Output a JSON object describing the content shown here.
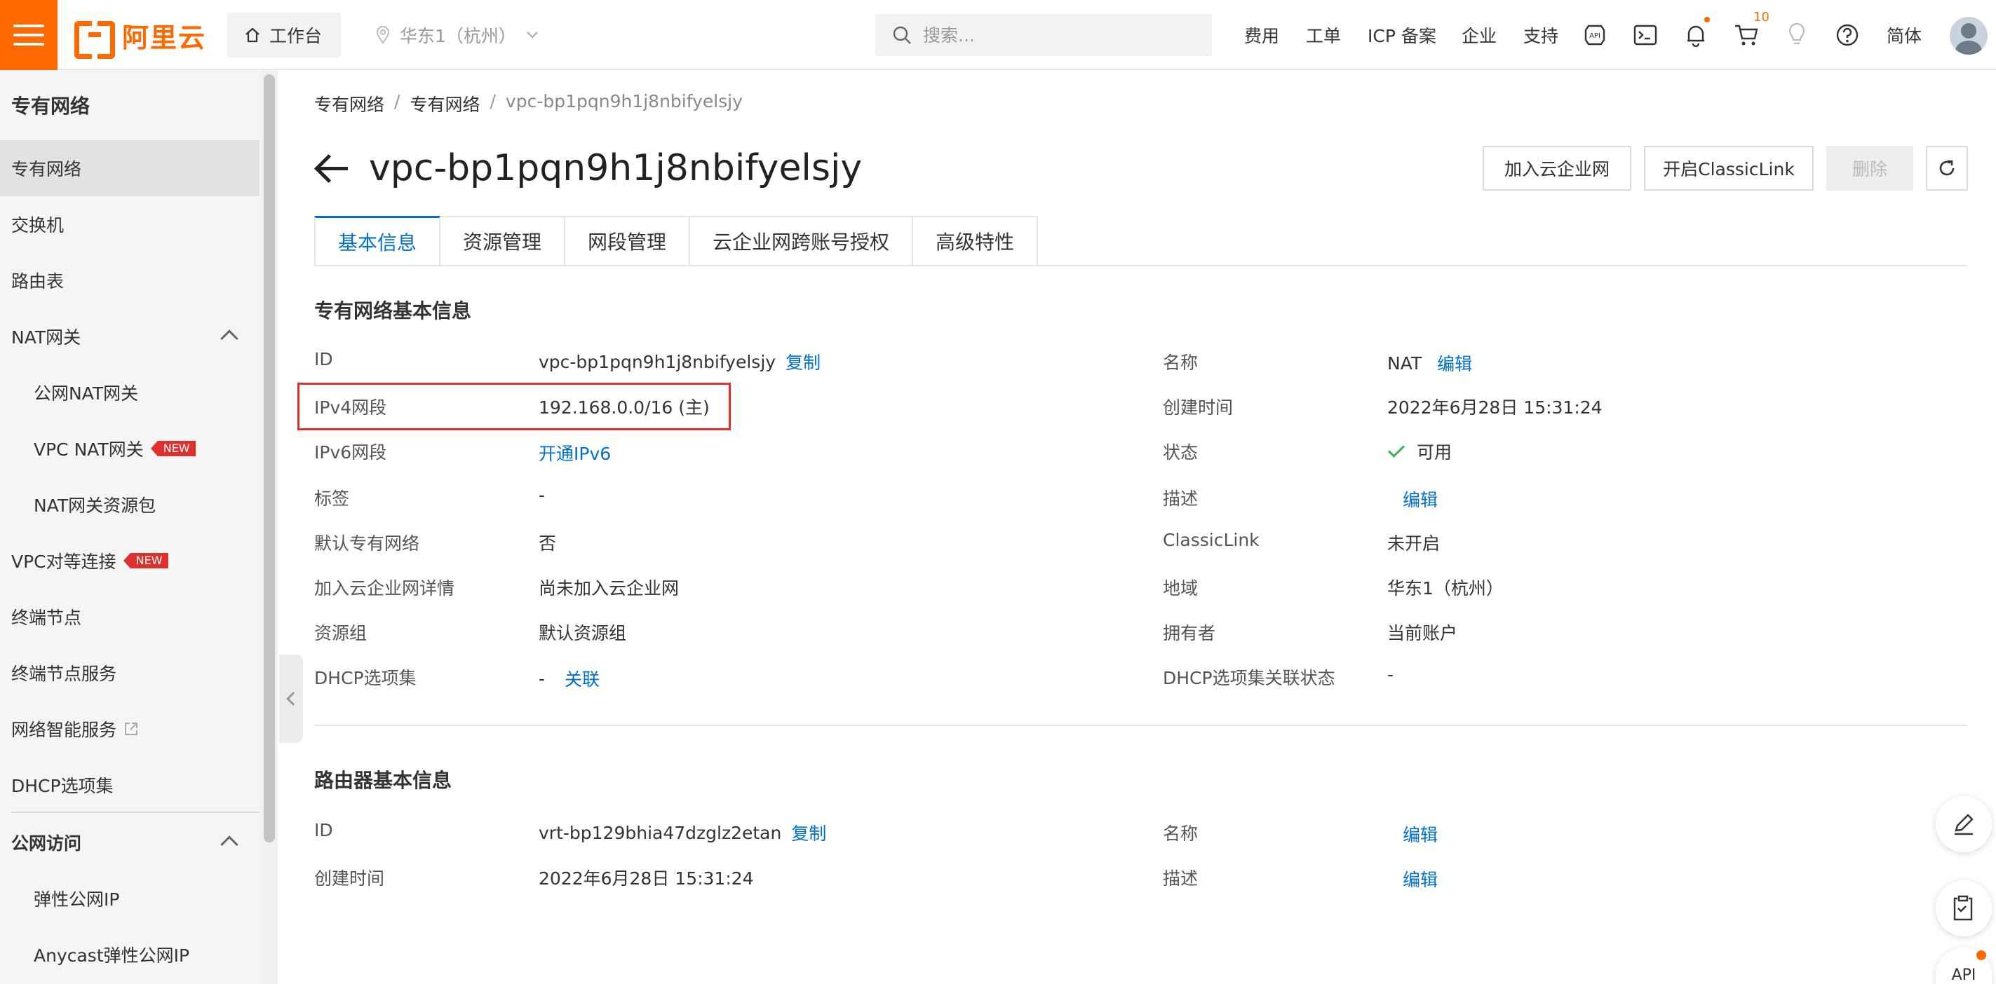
{
  "brand": {
    "name": "阿里云",
    "color": "#ff6a00"
  },
  "topbar": {
    "workbench": "工作台",
    "region": "华东1（杭州）",
    "search_placeholder": "搜索...",
    "nav": [
      "费用",
      "工单",
      "ICP 备案",
      "企业",
      "支持"
    ],
    "cart_count": "10",
    "lang": "简体",
    "icons": [
      "api-icon",
      "terminal-icon",
      "bell-icon",
      "cart-icon",
      "bulb-icon",
      "help-icon"
    ]
  },
  "sidebar": {
    "title": "专有网络",
    "items": [
      {
        "label": "专有网络",
        "active": true
      },
      {
        "label": "交换机"
      },
      {
        "label": "路由表"
      },
      {
        "label": "NAT网关"
      },
      {
        "label": "公网NAT网关"
      },
      {
        "label": "VPC NAT网关",
        "badge": "NEW"
      },
      {
        "label": "NAT网关资源包"
      },
      {
        "label": "VPC对等连接",
        "badge": "NEW"
      },
      {
        "label": "终端节点"
      },
      {
        "label": "终端节点服务"
      },
      {
        "label": "网络智能服务"
      },
      {
        "label": "DHCP选项集"
      },
      {
        "label": "公网访问"
      },
      {
        "label": "弹性公网IP"
      },
      {
        "label": "Anycast弹性公网IP"
      }
    ]
  },
  "breadcrumb": [
    "专有网络",
    "专有网络",
    "vpc-bp1pqn9h1j8nbifyelsjy"
  ],
  "page": {
    "title": "vpc-bp1pqn9h1j8nbifyelsjy",
    "actions": [
      "加入云企业网",
      "开启ClassicLink",
      "删除"
    ]
  },
  "tabs": [
    "基本信息",
    "资源管理",
    "网段管理",
    "云企业网跨账号授权",
    "高级特性"
  ],
  "vpc_info": {
    "title": "专有网络基本信息",
    "left": [
      {
        "label": "ID",
        "value": "vpc-bp1pqn9h1j8nbifyelsjy",
        "link": "复制"
      },
      {
        "label": "IPv4网段",
        "value": "192.168.0.0/16 (主)"
      },
      {
        "label": "IPv6网段",
        "value": "",
        "link": "开通IPv6"
      },
      {
        "label": "标签",
        "value": "-"
      },
      {
        "label": "默认专有网络",
        "value": "否"
      },
      {
        "label": "加入云企业网详情",
        "value": "尚未加入云企业网"
      },
      {
        "label": "资源组",
        "value": "默认资源组"
      },
      {
        "label": "DHCP选项集",
        "value": "-",
        "link": "关联"
      }
    ],
    "right": [
      {
        "label": "名称",
        "value": "NAT",
        "link": "编辑"
      },
      {
        "label": "创建时间",
        "value": "2022年6月28日 15:31:24"
      },
      {
        "label": "状态",
        "value": "可用"
      },
      {
        "label": "描述",
        "value": "",
        "link": "编辑"
      },
      {
        "label": "ClassicLink",
        "value": "未开启"
      },
      {
        "label": "地域",
        "value": "华东1（杭州）"
      },
      {
        "label": "拥有者",
        "value": "当前账户"
      },
      {
        "label": "DHCP选项集关联状态",
        "value": "-"
      }
    ]
  },
  "router_info": {
    "title": "路由器基本信息",
    "left": [
      {
        "label": "ID",
        "value": "vrt-bp129bhia47dzglz2etan",
        "link": "复制"
      },
      {
        "label": "创建时间",
        "value": "2022年6月28日 15:31:24"
      }
    ],
    "right": [
      {
        "label": "名称",
        "value": "",
        "link": "编辑"
      },
      {
        "label": "描述",
        "value": "",
        "link": "编辑"
      }
    ]
  },
  "float_api_label": "API"
}
